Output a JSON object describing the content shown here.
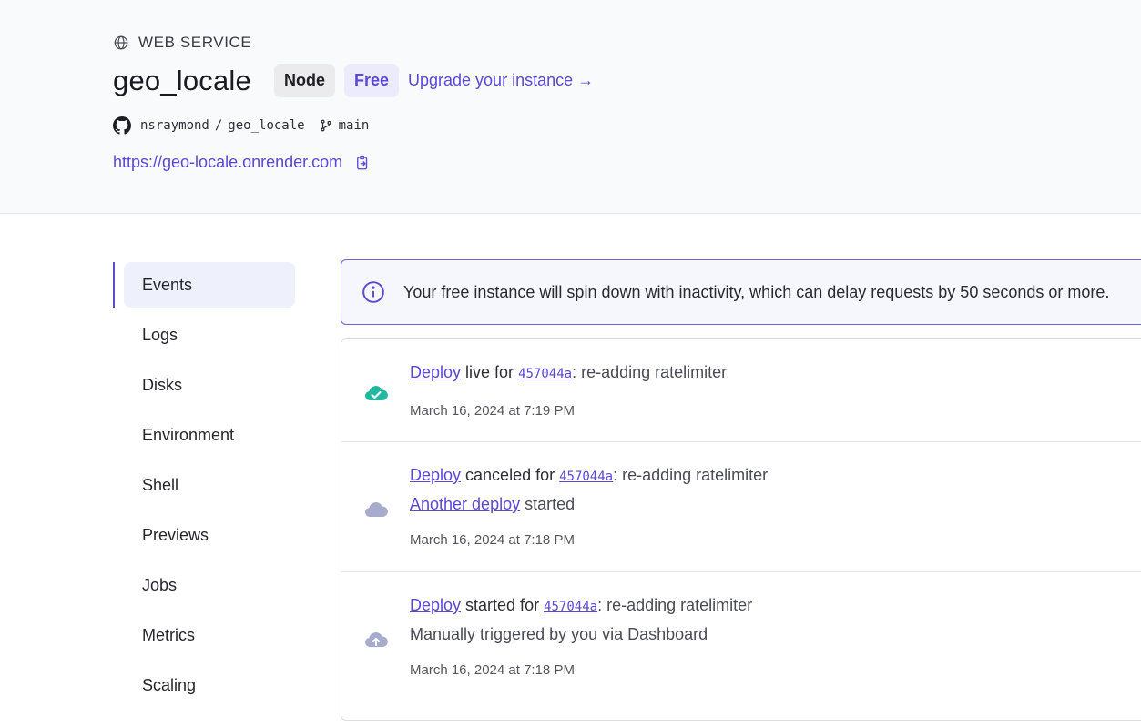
{
  "header": {
    "service_type": "WEB SERVICE",
    "title": "geo_locale",
    "runtime_badge": "Node",
    "plan_badge": "Free",
    "upgrade_link": "Upgrade your instance →",
    "repo_owner": "nsraymond",
    "repo_separator": "/",
    "repo_name": "geo_locale",
    "branch": "main",
    "url": "https://geo-locale.onrender.com"
  },
  "sidebar": {
    "items": [
      {
        "label": "Events",
        "active": true
      },
      {
        "label": "Logs"
      },
      {
        "label": "Disks"
      },
      {
        "label": "Environment"
      },
      {
        "label": "Shell"
      },
      {
        "label": "Previews"
      },
      {
        "label": "Jobs"
      },
      {
        "label": "Metrics"
      },
      {
        "label": "Scaling"
      }
    ]
  },
  "banner": {
    "text": "Your free instance will spin down with inactivity, which can delay requests by 50 seconds or more."
  },
  "events": [
    {
      "icon": "cloud-check-icon",
      "link": "Deploy",
      "action": " live for ",
      "sha": "457044a",
      "message": ": re-adding ratelimiter",
      "time": "March 16, 2024 at 7:19 PM"
    },
    {
      "icon": "cloud-icon",
      "link": "Deploy",
      "action": " canceled for ",
      "sha": "457044a",
      "message": ": re-adding ratelimiter",
      "sub_link": "Another deploy",
      "sub_text": " started",
      "time": "March 16, 2024 at 7:18 PM"
    },
    {
      "icon": "cloud-upload-icon",
      "link": "Deploy",
      "action": " started for ",
      "sha": "457044a",
      "message": ": re-adding ratelimiter",
      "sub_text": "Manually triggered by you via Dashboard",
      "time": "March 16, 2024 at 7:18 PM"
    }
  ],
  "colors": {
    "accent": "#5a48d6",
    "success": "#22b8a0",
    "muted_cloud": "#a7abcd"
  }
}
